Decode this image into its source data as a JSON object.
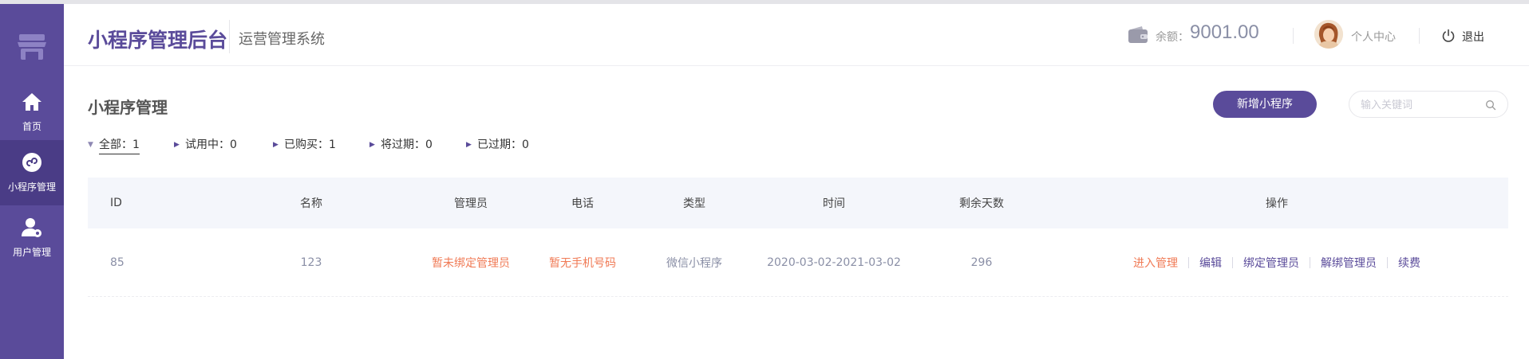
{
  "sidebar": {
    "logo_icon": "storefront-icon",
    "items": [
      {
        "label": "首页",
        "icon": "home-icon",
        "active": false
      },
      {
        "label": "小程序管理",
        "icon": "mini-program-icon",
        "active": true
      },
      {
        "label": "用户管理",
        "icon": "user-settings-icon",
        "active": false
      }
    ]
  },
  "header": {
    "title": "小程序管理后台",
    "subtitle": "运营管理系统",
    "balance_label": "余额：",
    "balance_value": "9001.00",
    "profile_label": "个人中心",
    "logout_label": "退出"
  },
  "page": {
    "title": "小程序管理",
    "add_button": "新增小程序",
    "search_placeholder": "输入关键词"
  },
  "filters": [
    {
      "label": "全部：1",
      "active": true
    },
    {
      "label": "试用中：0",
      "active": false
    },
    {
      "label": "已购买：1",
      "active": false
    },
    {
      "label": "将过期：0",
      "active": false
    },
    {
      "label": "已过期：0",
      "active": false
    }
  ],
  "table": {
    "columns": {
      "id": "ID",
      "name": "名称",
      "admin": "管理员",
      "phone": "电话",
      "type": "类型",
      "time": "时间",
      "days": "剩余天数",
      "ops": "操作"
    },
    "rows": [
      {
        "id": "85",
        "name": "123",
        "admin": "暂未绑定管理员",
        "phone": "暂无手机号码",
        "type": "微信小程序",
        "time": "2020-03-02-2021-03-02",
        "days": "296",
        "ops": [
          "进入管理",
          "编辑",
          "绑定管理员",
          "解绑管理员",
          "续费"
        ]
      }
    ]
  },
  "colors": {
    "brand": "#5a4b9a",
    "sidebar_active": "#4a3c86",
    "accent_red": "#f07a55"
  }
}
